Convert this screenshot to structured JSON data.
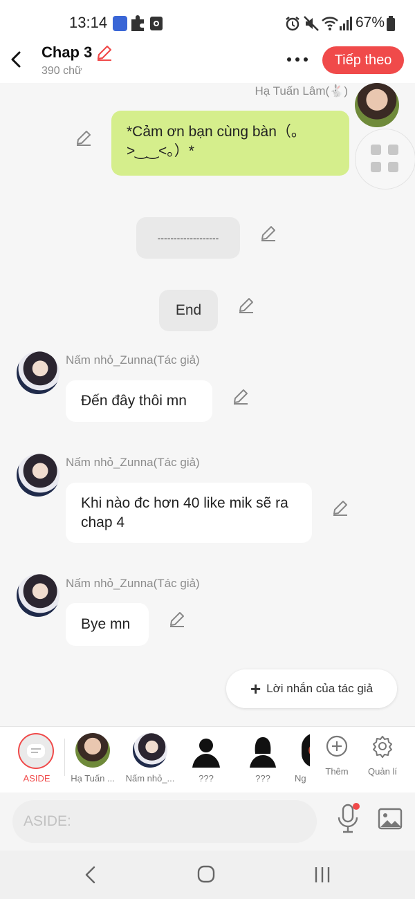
{
  "status_bar": {
    "time": "13:14",
    "battery": "67%",
    "app_badge": "NOVEL TOON"
  },
  "header": {
    "title": "Chap 3",
    "word_count": "390 chữ",
    "next_label": "Tiếp theo"
  },
  "messages": [
    {
      "sender": "Hạ Tuấn Lâm(🐇)",
      "text": "*Cảm ơn bạn cùng bàn（。>‿‿<。）*",
      "side": "right"
    },
    {
      "text": "-------------------",
      "type": "center"
    },
    {
      "text": "End",
      "type": "center"
    },
    {
      "sender": "Nấm nhỏ_Zunna(Tác giả)",
      "text": "Đến đây thôi mn",
      "side": "left"
    },
    {
      "sender": "Nấm nhỏ_Zunna(Tác giả)",
      "text": "Khi nào đc hơn 40 like mik sẽ ra chap 4",
      "side": "left"
    },
    {
      "sender": "Nấm nhỏ_Zunna(Tác giả)",
      "text": "Bye mn",
      "side": "left"
    }
  ],
  "author_note_label": "Lời nhắn của tác giả",
  "characters": [
    {
      "label": "ASIDE"
    },
    {
      "label": "Hạ Tuấn ..."
    },
    {
      "label": "Nấm nhỏ_..."
    },
    {
      "label": "???"
    },
    {
      "label": "???"
    },
    {
      "label": "Ng"
    }
  ],
  "more_label": "Thêm",
  "manage_label": "Quản lí",
  "input": {
    "placeholder": "ASIDE:"
  },
  "colors": {
    "accent": "#f04a4a",
    "green_bubble": "#d5ee8c",
    "background": "#f6f6f6"
  },
  "icons": [
    "back-arrow-icon",
    "edit-pencil-icon",
    "more-dots-icon",
    "grid-icon",
    "plus-icon",
    "settings-gear-icon",
    "microphone-icon",
    "image-icon",
    "alarm-icon",
    "mute-icon",
    "wifi-icon",
    "signal-icon",
    "battery-icon"
  ]
}
